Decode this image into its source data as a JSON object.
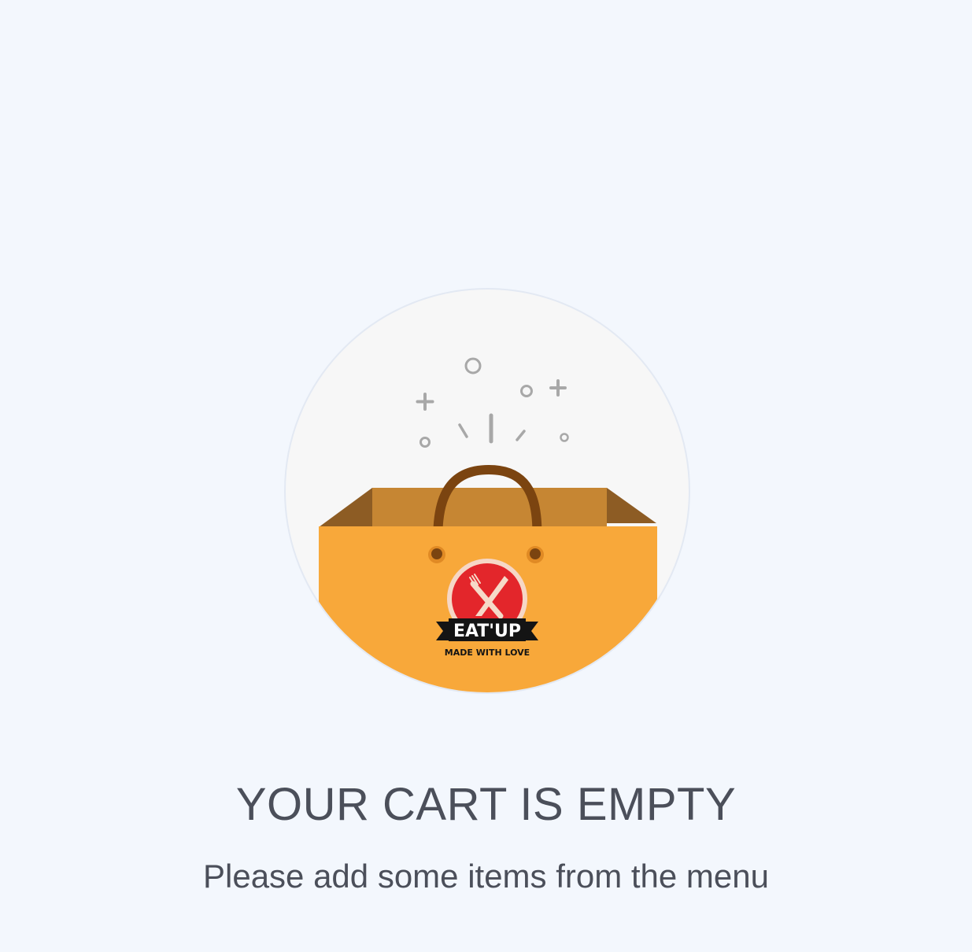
{
  "empty_cart": {
    "title": "YOUR CART IS EMPTY",
    "message": "Please add some items from the menu"
  },
  "logo": {
    "brand": "EAT'UP",
    "tagline": "MADE WITH LOVE"
  },
  "colors": {
    "background": "#f3f7fd",
    "circle": "#f7f7f7",
    "bag_front": "#f8a83a",
    "bag_inside": "#c68633",
    "bag_side": "#8d5c24",
    "handle": "#7b4410",
    "logo_red": "#e3262b",
    "text": "#4b4f5a"
  },
  "icons": {
    "illustration": "empty-shopping-bag-icon",
    "logo_symbol": "fork-knife-icon"
  }
}
